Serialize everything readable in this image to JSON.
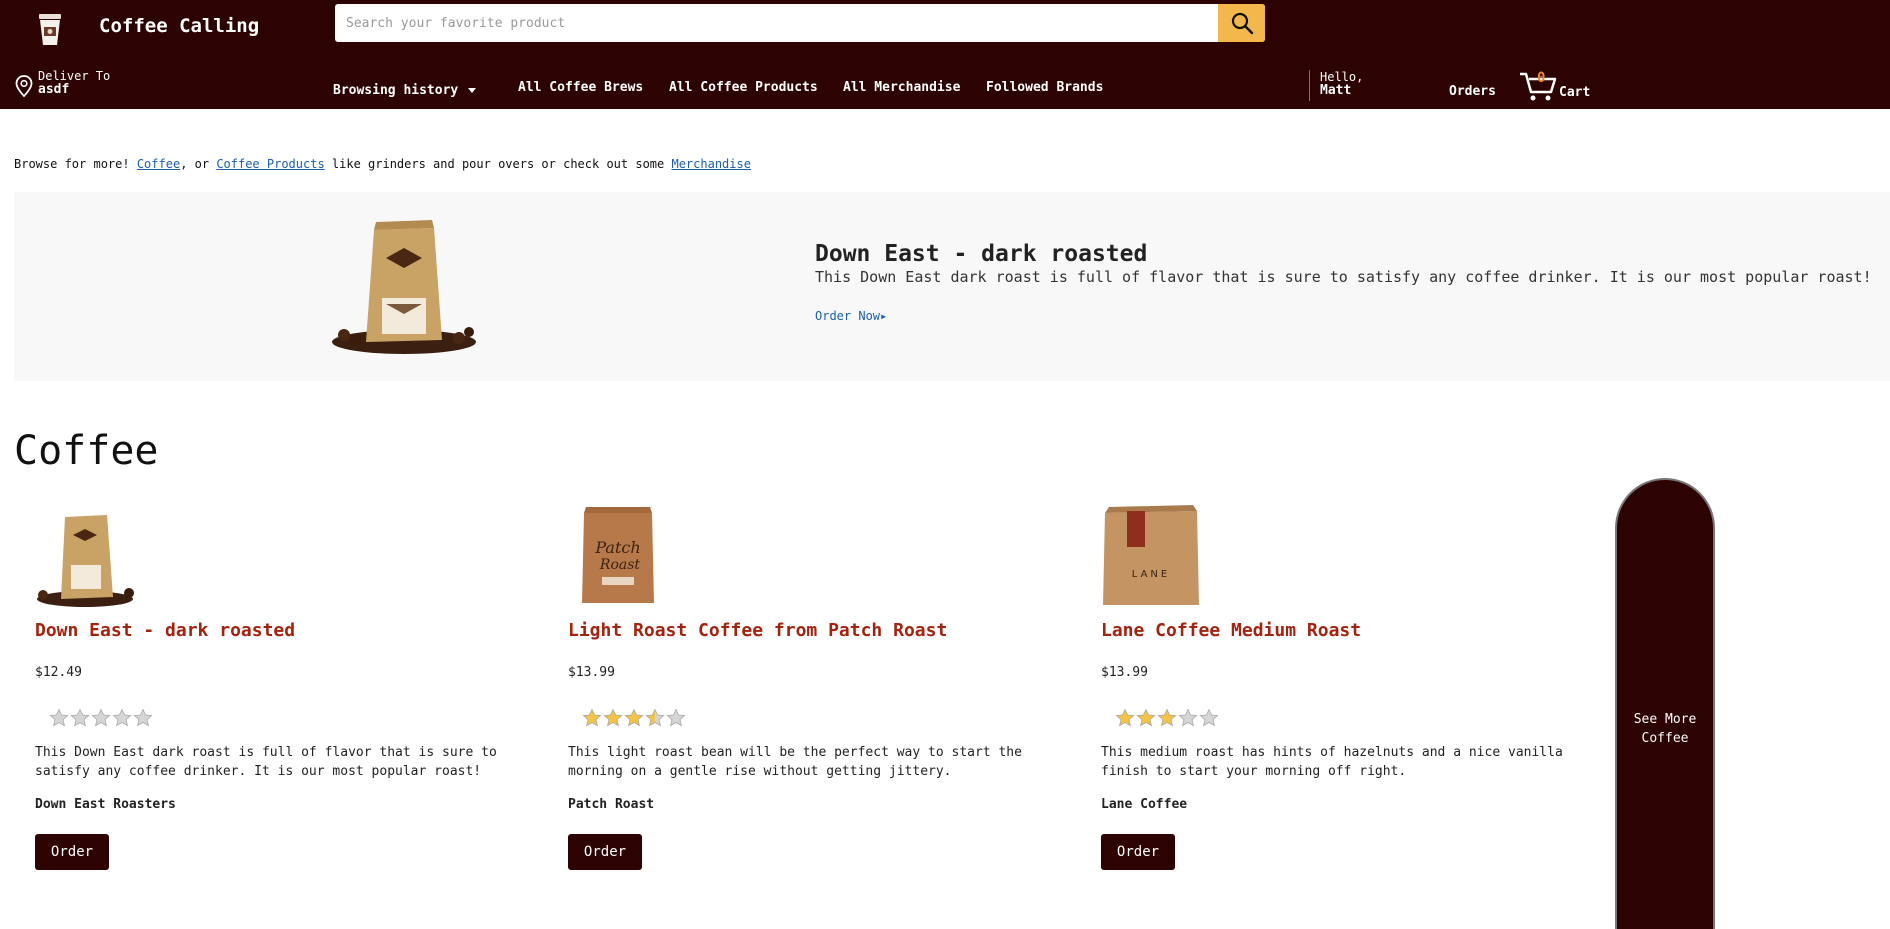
{
  "header": {
    "brand": "Coffee Calling",
    "search_placeholder": "Search your favorite product",
    "deliver_label": "Deliver To",
    "deliver_value": "asdf",
    "nav": {
      "history": "Browsing history",
      "brews": "All Coffee Brews",
      "products": "All Coffee Products",
      "merch": "All Merchandise",
      "brands": "Followed Brands"
    },
    "hello_label": "Hello,",
    "user_name": "Matt",
    "orders": "Orders",
    "cart_count": "0",
    "cart_label": "Cart"
  },
  "browse": {
    "prefix": "Browse for more! ",
    "link1": "Coffee",
    "mid1": ", or ",
    "link2": "Coffee Products",
    "mid2": " like grinders and pour overs or check out some ",
    "link3": "Merchandise"
  },
  "hero": {
    "title": "Down East - dark roasted",
    "description": "This Down East dark roast is full of flavor that is sure to satisfy any coffee drinker. It is our most popular roast!",
    "link": "Order Now▸"
  },
  "section": {
    "title": "Coffee",
    "see_more": "See More Coffee",
    "products": [
      {
        "name": "Down East - dark roasted",
        "price": "$12.49",
        "rating": 0,
        "description": "This Down East dark roast is full of flavor that is sure to satisfy any coffee drinker. It is our most popular roast!",
        "brand": "Down East Roasters",
        "order_label": "Order"
      },
      {
        "name": "Light Roast Coffee from Patch Roast",
        "price": "$13.99",
        "rating": 3.5,
        "description": "This light roast bean will be the perfect way to start the morning on a gentle rise without getting jittery.",
        "brand": "Patch Roast",
        "order_label": "Order"
      },
      {
        "name": "Lane Coffee Medium Roast",
        "price": "$13.99",
        "rating": 3,
        "description": "This medium roast has hints of hazelnuts and a nice vanilla finish to start your morning off right.",
        "brand": "Lane Coffee",
        "order_label": "Order"
      }
    ]
  },
  "colors": {
    "header_bg": "#2d0202",
    "accent": "#f3b74c",
    "product_name": "#a4220e",
    "star_filled": "#f6c343",
    "star_empty": "#d6d6d6"
  }
}
